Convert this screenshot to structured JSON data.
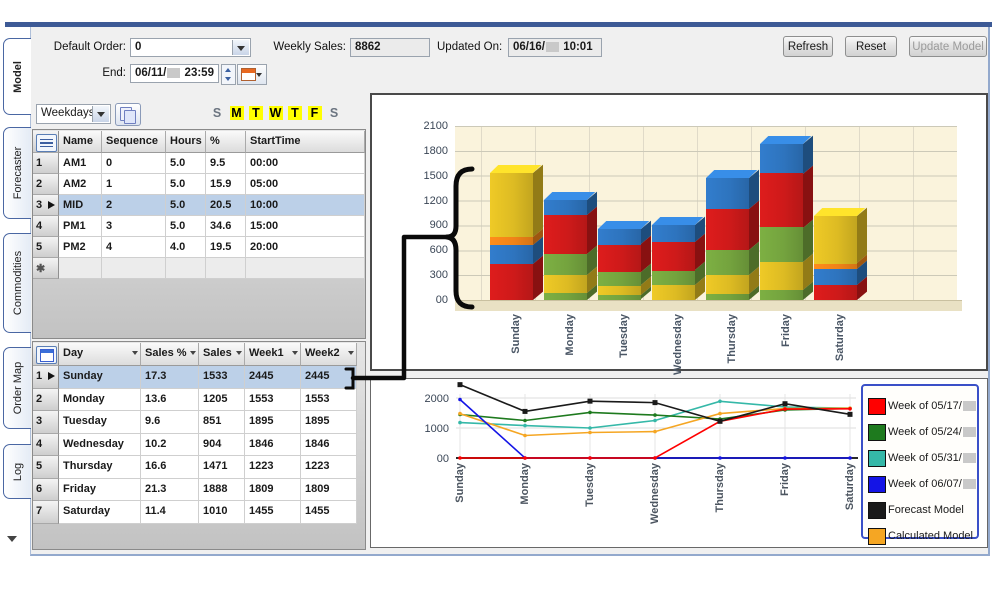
{
  "tabs": {
    "items": [
      {
        "label": "Model",
        "active": true
      },
      {
        "label": "Forecaster",
        "active": false
      },
      {
        "label": "Commodities",
        "active": false
      },
      {
        "label": "Order Map",
        "active": false
      },
      {
        "label": "Log",
        "active": false
      }
    ]
  },
  "toolbar": {
    "default_order": {
      "label": "Default Order:",
      "value": "0"
    },
    "end": {
      "label": "End:",
      "value_prefix": "06/11/",
      "redacted": true,
      "value_suffix": "23:59"
    },
    "weekly_sales": {
      "label": "Weekly Sales:",
      "value": "8862"
    },
    "updated_on": {
      "label": "Updated On:",
      "value_prefix": "06/16/",
      "redacted": true,
      "value_suffix": "10:01"
    },
    "buttons": [
      {
        "label": "Refresh",
        "enabled": true
      },
      {
        "label": "Reset",
        "enabled": true
      },
      {
        "label": "Update Model",
        "enabled": false
      }
    ]
  },
  "daypart_section": {
    "period_selector": {
      "value": "Weekdays"
    },
    "icons": {
      "period_dropdown": "chevron-down-icon",
      "copy": "copy-icon"
    },
    "day_letters": [
      {
        "letter": "S",
        "active": false
      },
      {
        "letter": "M",
        "active": true
      },
      {
        "letter": "T",
        "active": true
      },
      {
        "letter": "W",
        "active": true
      },
      {
        "letter": "T",
        "active": true
      },
      {
        "letter": "F",
        "active": true
      },
      {
        "letter": "S",
        "active": false
      }
    ],
    "grid": {
      "columns": [
        "Name",
        "Sequence",
        "Hours",
        "%",
        "StartTime"
      ],
      "rows": [
        {
          "num": "1",
          "cells": [
            "AM1",
            "0",
            "5.0",
            "9.5",
            "00:00"
          ]
        },
        {
          "num": "2",
          "cells": [
            "AM2",
            "1",
            "5.0",
            "15.9",
            "05:00"
          ]
        },
        {
          "num": "3",
          "cells": [
            "MID",
            "2",
            "5.0",
            "20.5",
            "10:00"
          ]
        },
        {
          "num": "4",
          "cells": [
            "PM1",
            "3",
            "5.0",
            "34.6",
            "15:00"
          ]
        },
        {
          "num": "5",
          "cells": [
            "PM2",
            "4",
            "4.0",
            "19.5",
            "20:00"
          ]
        }
      ],
      "selected_row_index": 2,
      "new_row_symbol": "✱"
    }
  },
  "day_section": {
    "grid": {
      "columns": [
        "Day",
        "Sales %",
        "Sales",
        "Week1",
        "Week2"
      ],
      "rows": [
        {
          "num": "1",
          "cells": [
            "Sunday",
            "17.3",
            "1533",
            "2445",
            "2445"
          ]
        },
        {
          "num": "2",
          "cells": [
            "Monday",
            "13.6",
            "1205",
            "1553",
            "1553"
          ]
        },
        {
          "num": "3",
          "cells": [
            "Tuesday",
            "9.6",
            "851",
            "1895",
            "1895"
          ]
        },
        {
          "num": "4",
          "cells": [
            "Wednesday",
            "10.2",
            "904",
            "1846",
            "1846"
          ]
        },
        {
          "num": "5",
          "cells": [
            "Thursday",
            "16.6",
            "1471",
            "1223",
            "1223"
          ]
        },
        {
          "num": "6",
          "cells": [
            "Friday",
            "21.3",
            "1888",
            "1809",
            "1809"
          ]
        },
        {
          "num": "7",
          "cells": [
            "Saturday",
            "11.4",
            "1010",
            "1455",
            "1455"
          ]
        }
      ],
      "selected_row_index": 0
    }
  },
  "chart_data": [
    {
      "type": "bar",
      "style": "3d-stacked",
      "categories": [
        "Sunday",
        "Monday",
        "Tuesday",
        "Wednesday",
        "Thursday",
        "Friday",
        "Saturday"
      ],
      "ylim": [
        0,
        2100
      ],
      "ytick_labels": [
        "00",
        "300",
        "600",
        "900",
        "1200",
        "1500",
        "1800",
        "2100"
      ],
      "grid": true,
      "totals": [
        1533,
        1205,
        851,
        904,
        1471,
        1888,
        1010
      ],
      "segment_colors": {
        "red": "#ce1a1a",
        "blue": "#2e74be",
        "yellow": "#ddbb23",
        "green": "#74a33e",
        "orange": "#f08318"
      },
      "bars": [
        {
          "category": "Sunday",
          "segments": [
            [
              "red",
              430
            ],
            [
              "blue",
              230
            ],
            [
              "orange",
              95
            ],
            [
              "yellow",
              778
            ]
          ]
        },
        {
          "category": "Monday",
          "segments": [
            [
              "green",
              85
            ],
            [
              "yellow",
              215
            ],
            [
              "green",
              255
            ],
            [
              "red",
              465
            ],
            [
              "blue",
              185
            ]
          ]
        },
        {
          "category": "Tuesday",
          "segments": [
            [
              "green",
              55
            ],
            [
              "yellow",
              115
            ],
            [
              "green",
              165
            ],
            [
              "red",
              330
            ],
            [
              "blue",
              186
            ]
          ]
        },
        {
          "category": "Wednesday",
          "segments": [
            [
              "yellow",
              175
            ],
            [
              "green",
              180
            ],
            [
              "red",
              345
            ],
            [
              "blue",
              204
            ]
          ]
        },
        {
          "category": "Thursday",
          "segments": [
            [
              "green",
              70
            ],
            [
              "yellow",
              230
            ],
            [
              "green",
              300
            ],
            [
              "red",
              500
            ],
            [
              "blue",
              371
            ]
          ]
        },
        {
          "category": "Friday",
          "segments": [
            [
              "green",
              120
            ],
            [
              "yellow",
              340
            ],
            [
              "green",
              420
            ],
            [
              "red",
              650
            ],
            [
              "blue",
              358
            ]
          ]
        },
        {
          "category": "Saturday",
          "segments": [
            [
              "red",
              175
            ],
            [
              "blue",
              195
            ],
            [
              "orange",
              70
            ],
            [
              "yellow",
              570
            ]
          ]
        }
      ]
    },
    {
      "type": "line",
      "categories": [
        "Sunday",
        "Monday",
        "Tuesday",
        "Wednesday",
        "Thursday",
        "Friday",
        "Saturday"
      ],
      "ylim": [
        0,
        2400
      ],
      "yticks": [
        0,
        1000,
        2000
      ],
      "ytick_labels": [
        "00",
        "1000",
        "2000"
      ],
      "grid": true,
      "legend_position": "right",
      "series": [
        {
          "name": "Week of 05/17/",
          "redacted": true,
          "color": "#ff0000",
          "values": [
            0,
            0,
            0,
            0,
            1223,
            1630,
            1640
          ]
        },
        {
          "name": "Week of 05/24/",
          "redacted": true,
          "color": "#1e7a1e",
          "values": [
            1450,
            1250,
            1520,
            1430,
            1300,
            1600,
            1650
          ]
        },
        {
          "name": "Week of 05/31/",
          "redacted": true,
          "color": "#35b8a8",
          "values": [
            1180,
            1080,
            1000,
            1250,
            1890,
            1700,
            1660
          ]
        },
        {
          "name": "Week of 06/07/",
          "redacted": true,
          "color": "#1414e6",
          "values": [
            1950,
            0,
            0,
            0,
            0,
            0,
            0
          ]
        },
        {
          "name": "Forecast Model",
          "redacted": false,
          "color": "#1a1a1a",
          "values": [
            2445,
            1553,
            1895,
            1846,
            1223,
            1809,
            1455
          ],
          "markers": true
        },
        {
          "name": "Calculated Model",
          "redacted": false,
          "color": "#f5a623",
          "values": [
            1480,
            750,
            850,
            880,
            1480,
            1650,
            1660
          ]
        }
      ]
    }
  ]
}
